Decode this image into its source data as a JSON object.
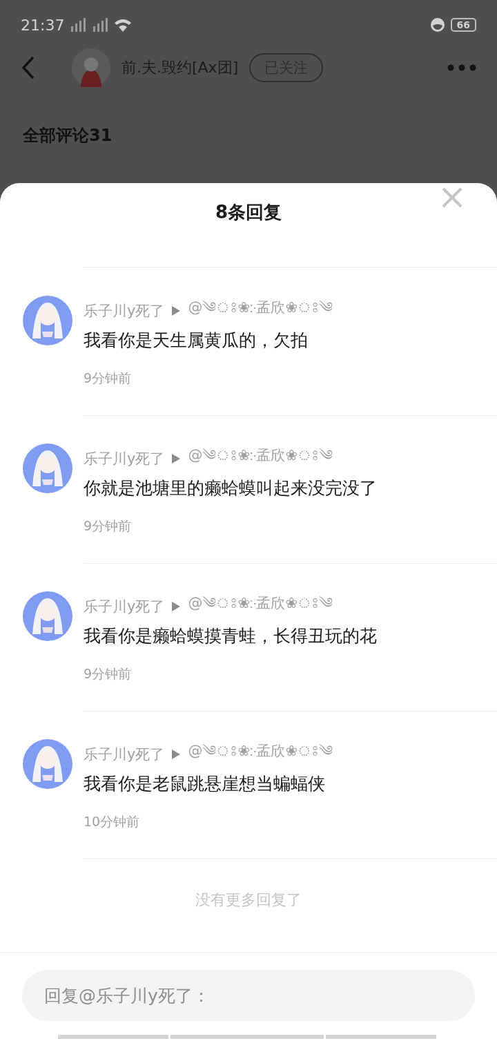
{
  "status_bar": {
    "time": "21:37",
    "battery": "66"
  },
  "header": {
    "username": "前.夫.毁约[Ax团]",
    "follow_button": "已关注"
  },
  "section_title": "全部评论31",
  "sheet": {
    "title": "8条回复",
    "replies": [
      {
        "author": "乐子川y死了",
        "target": "@༄ঃ❀჻孟欣❀ঃ༄",
        "text": "我看你是天生属黄瓜的，欠拍",
        "time": "9分钟前"
      },
      {
        "author": "乐子川y死了",
        "target": "@༄ঃ❀჻孟欣❀ঃ༄",
        "text": "你就是池塘里的癞蛤蟆叫起来没完没了",
        "time": "9分钟前"
      },
      {
        "author": "乐子川y死了",
        "target": "@༄ঃ❀჻孟欣❀ঃ༄",
        "text": "我看你是癞蛤蟆摸青蛙，长得丑玩的花",
        "time": "9分钟前"
      },
      {
        "author": "乐子川y死了",
        "target": "@༄ঃ❀჻孟欣❀ঃ༄",
        "text": "我看你是老鼠跳悬崖想当蝙蝠侠",
        "time": "10分钟前"
      }
    ],
    "end_note": "没有更多回复了",
    "reply_input": {
      "placeholder": "回复@乐子川y死了："
    }
  }
}
